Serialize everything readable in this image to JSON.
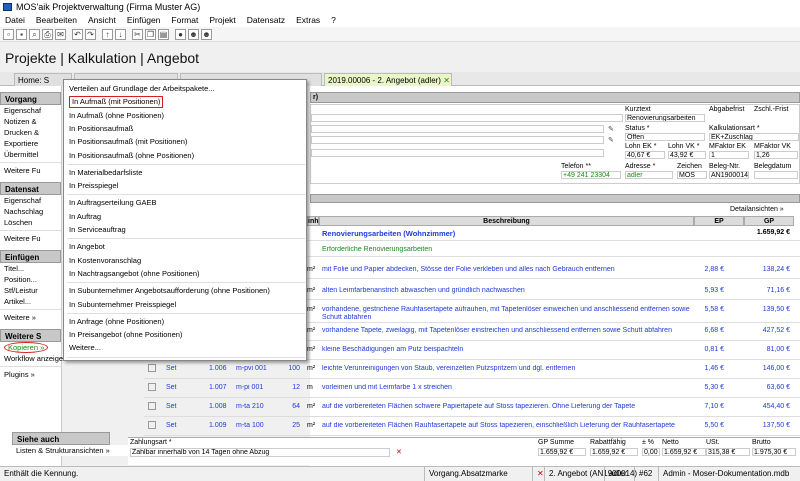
{
  "window": {
    "title": "MOS'aik Projektverwaltung (Firma Muster AG)"
  },
  "menu": [
    "Datei",
    "Bearbeiten",
    "Ansicht",
    "Einfügen",
    "Format",
    "Projekt",
    "Datensatz",
    "Extras",
    "?"
  ],
  "header": {
    "title": "Projekte | Kalkulation | Angebot"
  },
  "tabs": [
    "Home: S",
    "2019.00006 - 2. Angebot (adler)"
  ],
  "sidebar": {
    "vorgang_head": "Vorgang",
    "vorgang_items": [
      "Eigenschaf",
      "Notizen &",
      "Drucken &",
      "Exportiere",
      "Übermittel",
      "Weitere Fu"
    ],
    "datensatz_head": "Datensat",
    "datensatz_items": [
      "Eigenschaf",
      "Nachschlag",
      "Löschen",
      "Weitere Fu"
    ],
    "einfuegen_head": "Einfügen",
    "einfuegen_items": [
      "Titel...",
      "Position...",
      "Stf/Leistur",
      "Artikel...",
      "Weitere »"
    ],
    "weitere_head": "Weitere S",
    "weitere_items": [
      "Kopieren »",
      "Workflow anzeigen...",
      "Plugins »"
    ],
    "siehe_head": "Siehe auch",
    "siehe_items": [
      "Listen & Strukturansichten »"
    ]
  },
  "popup": {
    "items": [
      "Verteilen auf Grundlage der Arbeitspakete...",
      "In Aufmaß (mit Positionen)",
      "In Aufmaß (ohne Positionen)",
      "In Positionsaufmaß",
      "In Positionsaufmaß (mit Positionen)",
      "In Positionsaufmaß (ohne Positionen)",
      "In Materialbedarfsliste",
      "In Preisspiegel",
      "In Auftragserteilung GAEB",
      "In Auftrag",
      "In Serviceauftrag",
      "In Angebot",
      "In Kostenvoranschlag",
      "In Nachtragsangebot (ohne Positionen)",
      "In Subunternehmer Angebotsaufforderung (ohne Positionen)",
      "In Subunternehmer Preisspiegel",
      "In Anfrage (ohne Positionen)",
      "In Preisangebot (ohne Positionen)",
      "Weitere..."
    ]
  },
  "info": {
    "kurztext_lbl": "Kurztext",
    "kurztext": "Renovierungsarbeiten",
    "abgabefrist_lbl": "Abgabefrist",
    "zschl_lbl": "Zschl.-Frist",
    "status_lbl": "Status *",
    "status": "Offen",
    "kalk_lbl": "Kalkulationsart *",
    "kalk": "EK+Zuschlag",
    "lohnek_lbl": "Lohn EK *",
    "lohnek": "40,67 €",
    "lohnvk_lbl": "Lohn VK *",
    "lohnvk": "43,92 €",
    "mfek_lbl": "MFaktor EK",
    "mfek": "1",
    "mfvk_lbl": "MFaktor VK",
    "mfvk": "1,26",
    "telefon_lbl": "Telefon **",
    "telefon": "+49 241 23304",
    "adresse_lbl": "Adresse *",
    "adresse": "adler",
    "zeichen_lbl": "Zeichen",
    "zeichen": "MOS",
    "beleg_lbl": "Beleg-Ntr.",
    "beleg": "AN1900014",
    "belegdatum_lbl": "Belegdatum"
  },
  "detail_link": "Detailansichten »",
  "grid": {
    "col_einh": "inh",
    "col_beschreibung": "Beschreibung",
    "col_ep": "EP",
    "col_gp": "GP",
    "title_row": {
      "text": "Renovierungsarbeiten (Wohnzimmer)",
      "gp": "1.659,92 €"
    },
    "subtitle": "Erforderliche Renovierungsarbeiten",
    "rows": [
      {
        "art": "",
        "pos": "",
        "nr": "",
        "menge": "",
        "einh": "m²",
        "text": "mit Folie und Papier abdecken, Stösse der Folie verkleben und alles nach Gebrauch entfernen",
        "text2": "",
        "ep": "2,88 €",
        "gp": "138,24 €"
      },
      {
        "art": "",
        "pos": "",
        "nr": "",
        "menge": "",
        "einh": "m²",
        "text": "alten Leimfarbenanstrich abwaschen und gründlich nachwaschen",
        "text2": "",
        "ep": "5,93 €",
        "gp": "71,16 €"
      },
      {
        "art": "",
        "pos": "",
        "nr": "",
        "menge": "",
        "einh": "m²",
        "text": "vorhandene, gestrichene Rauhfasertapete aufrauhen, mit Tapetenlöser einweichen und anschliessend entfernen sowie",
        "text2": "Schutt abfahren",
        "ep": "5,58 €",
        "gp": "139,50 €"
      },
      {
        "art": "",
        "pos": "",
        "nr": "",
        "menge": "",
        "einh": "m²",
        "text": "vorhandene Tapete, zweilagig, mit Tapetenlöser einstreichen und anschliessend entfernen sowie Schutt abfahren",
        "text2": "",
        "ep": "6,68 €",
        "gp": "427,52 €"
      },
      {
        "art": "",
        "pos": "",
        "nr": "",
        "menge": "",
        "einh": "m²",
        "text": "kleine Beschädigungen am Putz beispachteln",
        "text2": "",
        "ep": "0,81 €",
        "gp": "81,00 €"
      },
      {
        "art": "Set",
        "pos": "1.006",
        "nr": "m-pvi 001",
        "menge": "100",
        "einh": "m²",
        "text": "leichte Verunreinigungen von Staub, vereinzelten Putzspritzern und dgl. entfernen",
        "text2": "",
        "ep": "1,46 €",
        "gp": "146,00 €"
      },
      {
        "art": "Set",
        "pos": "1.007",
        "nr": "m-pi 001",
        "menge": "12",
        "einh": "m",
        "text": "vorleimen und mit Leimfarbe 1 x streichen",
        "text2": "",
        "ep": "5,30 €",
        "gp": "63,60 €"
      },
      {
        "art": "Set",
        "pos": "1.008",
        "nr": "m-ta 210",
        "menge": "64",
        "einh": "m²",
        "text": "auf die vorbereiteten Flächen schwere Papiertapete auf Stoss tapezieren. Ohne Lieferung der Tapete",
        "text2": "",
        "ep": "7,10 €",
        "gp": "454,40 €"
      },
      {
        "art": "Set",
        "pos": "1.009",
        "nr": "m-ta 100",
        "menge": "25",
        "einh": "m²",
        "text": "auf die vorbereiteten Flächen Rauhfasertapete auf Stoss tapezieren, einschließlich Lieferung der Rauhfasertapete",
        "text2": "",
        "ep": "5,50 €",
        "gp": "137,50 €"
      }
    ]
  },
  "footer": {
    "zahlungsart_lbl": "Zahlungsart *",
    "zahlungsart": "Zahlbar innerhalb von 14 Tagen ohne Abzug",
    "gpsumme_lbl": "GP Summe",
    "gpsumme": "1.659,92 €",
    "rabatt_lbl": "Rabattfähig",
    "rabatt": "1.659,92 €",
    "pct_lbl": "± %",
    "pct": "0,00 €",
    "netto_lbl": "Netto",
    "netto": "1.659,92 €",
    "ust_lbl": "USt.",
    "ust": "315,38 €",
    "brutto_lbl": "Brutto",
    "brutto": "1.975,30 €"
  },
  "status": {
    "left": "Enthält die Kennung.",
    "marke": "Vorgang.Absatzmarke",
    "doc": "2. Angebot (AN1900014)",
    "user": "adler",
    "num": "#62",
    "db": "Admin - Moser-Dokumentation.mdb"
  }
}
